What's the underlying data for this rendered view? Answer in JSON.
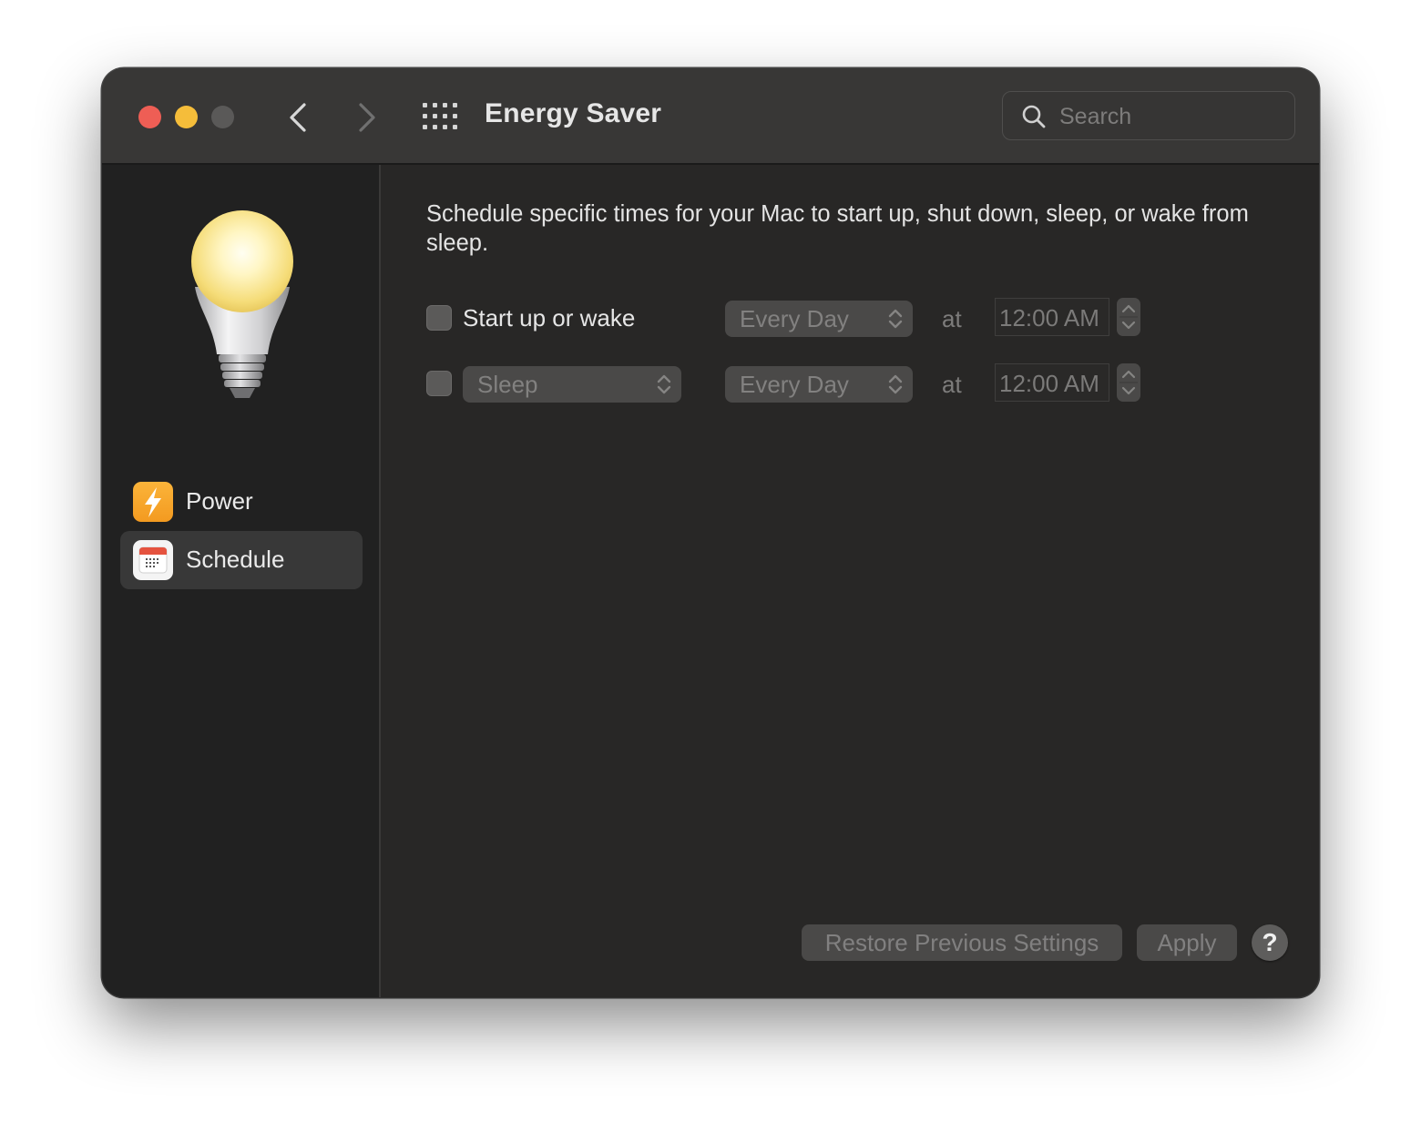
{
  "window": {
    "title": "Energy Saver",
    "search_placeholder": "Search"
  },
  "sidebar": {
    "items": [
      {
        "label": "Power",
        "icon": "lightning-bolt-icon",
        "selected": false
      },
      {
        "label": "Schedule",
        "icon": "calendar-icon",
        "selected": true
      }
    ]
  },
  "content": {
    "description": "Schedule specific times for your Mac to start up, shut down, sleep, or wake from sleep.",
    "rows": [
      {
        "checked": false,
        "label": "Start up or wake",
        "frequency": "Every Day",
        "at": "at",
        "time": "12:00 AM"
      },
      {
        "checked": false,
        "action": "Sleep",
        "frequency": "Every Day",
        "at": "at",
        "time": "12:00 AM"
      }
    ],
    "buttons": {
      "restore": "Restore Previous Settings",
      "apply": "Apply",
      "help": "?"
    }
  },
  "colors": {
    "close": "#ee5e55",
    "minimize": "#f5bd3a",
    "zoom_disabled": "#5a5958",
    "power_icon": "#f7a52b"
  }
}
